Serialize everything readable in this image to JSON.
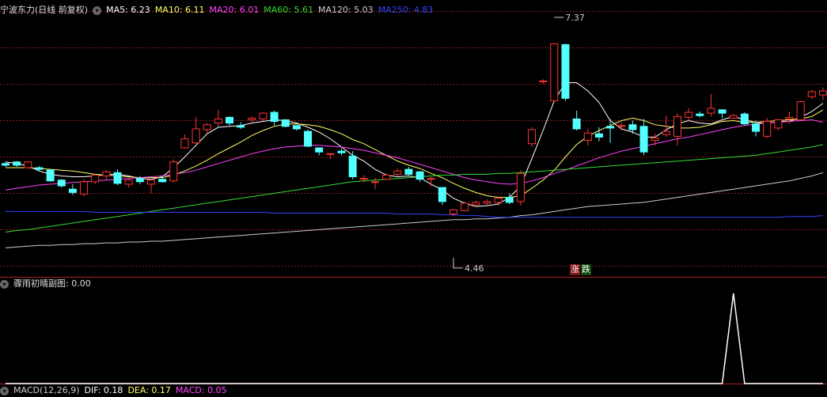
{
  "main_header": {
    "title": "宁波东力(日线 前复权)",
    "indicators": [
      {
        "label": "MA5: 6.23",
        "color": "#ffffff"
      },
      {
        "label": "MA10: 6.11",
        "color": "#ffff66"
      },
      {
        "label": "MA20: 6.01",
        "color": "#ff44ff"
      },
      {
        "label": "MA60: 5.61",
        "color": "#33dd33"
      },
      {
        "label": "MA120: 5.03",
        "color": "#cccccc"
      },
      {
        "label": "MA250: 4.83",
        "color": "#3344ff"
      }
    ]
  },
  "sub_header": {
    "title": "骤雨初晴副图",
    "value": ": 0.00"
  },
  "bottom_header": {
    "labels": [
      {
        "text": "MACD(12,26,9)",
        "color": "#cccccc"
      },
      {
        "text": "DIF: 0.18",
        "color": "#ffffff"
      },
      {
        "text": "DEA: 0.17",
        "color": "#ffff66"
      },
      {
        "text": "MACD: 0.05",
        "color": "#ff44ff"
      }
    ]
  },
  "badges": {
    "up": "涨",
    "down": "跌"
  },
  "colors": {
    "up": "#ff3333",
    "down": "#54ffff",
    "grid": "#8b1a1a",
    "divider": "#b02020",
    "axis_text": "#cccccc"
  },
  "chart_data": {
    "type": "candlestick",
    "ylim": [
      4.21,
      7.58
    ],
    "annotations": [
      {
        "text": "7.37",
        "kind": "high",
        "value": 7.37,
        "index": 49
      },
      {
        "text": "4.46",
        "kind": "low",
        "value": 4.46,
        "index": 40
      }
    ],
    "candles": [
      [
        5.6,
        5.62,
        5.56,
        5.58
      ],
      [
        5.62,
        5.63,
        5.56,
        5.58
      ],
      [
        5.55,
        5.63,
        5.54,
        5.62
      ],
      [
        5.55,
        5.57,
        5.51,
        5.53
      ],
      [
        5.52,
        5.53,
        5.38,
        5.39
      ],
      [
        5.4,
        5.41,
        5.31,
        5.33
      ],
      [
        5.29,
        5.35,
        5.22,
        5.25
      ],
      [
        5.23,
        5.41,
        5.2,
        5.38
      ],
      [
        5.38,
        5.48,
        5.35,
        5.46
      ],
      [
        5.45,
        5.52,
        5.4,
        5.5
      ],
      [
        5.49,
        5.53,
        5.34,
        5.36
      ],
      [
        5.35,
        5.42,
        5.31,
        5.4
      ],
      [
        5.42,
        5.45,
        5.35,
        5.38
      ],
      [
        5.35,
        5.42,
        5.24,
        5.4
      ],
      [
        5.41,
        5.45,
        5.37,
        5.38
      ],
      [
        5.39,
        5.65,
        5.37,
        5.62
      ],
      [
        5.79,
        5.95,
        5.78,
        5.9
      ],
      [
        5.85,
        6.16,
        5.84,
        6.02
      ],
      [
        6.01,
        6.09,
        5.97,
        6.07
      ],
      [
        6.09,
        6.25,
        6.05,
        6.14
      ],
      [
        6.16,
        6.17,
        6.06,
        6.09
      ],
      [
        6.06,
        6.1,
        6.02,
        6.04
      ],
      [
        6.13,
        6.17,
        6.1,
        6.15
      ],
      [
        6.14,
        6.22,
        6.12,
        6.21
      ],
      [
        6.22,
        6.24,
        6.06,
        6.11
      ],
      [
        6.13,
        6.13,
        6.04,
        6.05
      ],
      [
        6.06,
        6.06,
        6.0,
        6.02
      ],
      [
        5.99,
        6.01,
        5.8,
        5.81
      ],
      [
        5.79,
        5.79,
        5.7,
        5.74
      ],
      [
        5.72,
        5.72,
        5.65,
        5.72
      ],
      [
        5.75,
        5.78,
        5.7,
        5.73
      ],
      [
        5.69,
        5.75,
        5.41,
        5.44
      ],
      [
        5.42,
        5.46,
        5.37,
        5.42
      ],
      [
        5.38,
        5.43,
        5.29,
        5.38
      ],
      [
        5.41,
        5.48,
        5.4,
        5.46
      ],
      [
        5.47,
        5.54,
        5.45,
        5.51
      ],
      [
        5.53,
        5.56,
        5.46,
        5.47
      ],
      [
        5.5,
        5.51,
        5.38,
        5.41
      ],
      [
        5.42,
        5.44,
        5.32,
        5.42
      ],
      [
        5.31,
        5.31,
        5.1,
        5.14
      ],
      [
        4.99,
        5.05,
        4.96,
        5.04
      ],
      [
        5.03,
        5.14,
        5.02,
        5.12
      ],
      [
        5.1,
        5.15,
        5.08,
        5.13
      ],
      [
        5.12,
        5.17,
        5.1,
        5.14
      ],
      [
        5.13,
        5.2,
        5.09,
        5.18
      ],
      [
        5.19,
        5.24,
        5.11,
        5.13
      ],
      [
        5.14,
        5.52,
        5.09,
        5.48
      ],
      [
        5.84,
        6.04,
        5.8,
        6.01
      ],
      [
        6.59,
        6.62,
        6.56,
        6.6
      ],
      [
        6.36,
        7.06,
        6.34,
        7.05
      ],
      [
        7.04,
        7.05,
        6.36,
        6.39
      ],
      [
        6.14,
        6.24,
        6.0,
        6.02
      ],
      [
        5.88,
        6.02,
        5.82,
        5.97
      ],
      [
        5.96,
        6.04,
        5.87,
        5.92
      ],
      [
        6.05,
        6.14,
        5.85,
        6.03
      ],
      [
        6.05,
        6.1,
        6.0,
        6.06
      ],
      [
        6.07,
        6.12,
        5.96,
        6.01
      ],
      [
        6.05,
        6.14,
        5.7,
        5.74
      ],
      [
        5.88,
        5.96,
        5.82,
        5.91
      ],
      [
        5.95,
        6.18,
        5.92,
        5.99
      ],
      [
        5.93,
        6.21,
        5.82,
        6.17
      ],
      [
        6.16,
        6.27,
        6.12,
        6.22
      ],
      [
        6.2,
        6.23,
        6.16,
        6.18
      ],
      [
        6.21,
        6.44,
        6.17,
        6.27
      ],
      [
        6.25,
        6.26,
        6.15,
        6.21
      ],
      [
        6.15,
        6.2,
        6.14,
        6.18
      ],
      [
        6.2,
        6.22,
        6.07,
        6.08
      ],
      [
        6.08,
        6.12,
        5.93,
        5.99
      ],
      [
        5.93,
        6.15,
        5.91,
        6.11
      ],
      [
        6.03,
        6.14,
        6.0,
        6.13
      ],
      [
        6.14,
        6.23,
        6.08,
        6.16
      ],
      [
        6.13,
        6.36,
        6.12,
        6.35
      ],
      [
        6.41,
        6.49,
        6.38,
        6.47
      ],
      [
        6.43,
        6.52,
        6.37,
        6.48
      ]
    ],
    "ma_series": [
      {
        "name": "MA5",
        "color": "#ffffff",
        "values": [
          5.62,
          5.6,
          5.57,
          5.51,
          5.47,
          5.45,
          5.44,
          5.44,
          5.45,
          5.47,
          5.47,
          5.45,
          5.42,
          5.41,
          5.44,
          5.55,
          5.68,
          5.82,
          5.96,
          6.04,
          6.05,
          6.06,
          6.09,
          6.11,
          6.13,
          6.12,
          6.09,
          6.04,
          5.98,
          5.9,
          5.8,
          5.7,
          5.63,
          5.53,
          5.46,
          5.44,
          5.45,
          5.43,
          5.35,
          5.28,
          5.18,
          5.12,
          5.08,
          5.09,
          5.11,
          5.19,
          5.33,
          5.66,
          6.0,
          6.36,
          6.58,
          6.58,
          6.48,
          6.34,
          6.12,
          6.02,
          5.98,
          5.92,
          5.92,
          6.01,
          6.08,
          6.12,
          6.09,
          6.08,
          6.13,
          6.17,
          6.13,
          6.1,
          6.08,
          6.11,
          6.11,
          6.16,
          6.23,
          6.33
        ]
      },
      {
        "name": "MA10",
        "color": "#ffff66",
        "values": [
          5.55,
          5.55,
          5.55,
          5.54,
          5.53,
          5.52,
          5.51,
          5.49,
          5.47,
          5.46,
          5.45,
          5.44,
          5.43,
          5.43,
          5.43,
          5.46,
          5.51,
          5.57,
          5.64,
          5.72,
          5.79,
          5.86,
          5.94,
          6.0,
          6.05,
          6.08,
          6.08,
          6.07,
          6.05,
          6.01,
          5.96,
          5.89,
          5.84,
          5.77,
          5.7,
          5.63,
          5.58,
          5.54,
          5.48,
          5.43,
          5.36,
          5.3,
          5.25,
          5.21,
          5.19,
          5.19,
          5.21,
          5.3,
          5.4,
          5.52,
          5.68,
          5.83,
          5.93,
          6.0,
          6.06,
          6.12,
          6.15,
          6.12,
          6.07,
          6.05,
          6.03,
          6.03,
          6.04,
          6.07,
          6.11,
          6.12,
          6.1,
          6.1,
          6.11,
          6.12,
          6.13,
          6.14,
          6.17,
          6.25
        ]
      },
      {
        "name": "MA20",
        "color": "#ff44ff",
        "values": [
          5.28,
          5.3,
          5.32,
          5.34,
          5.35,
          5.36,
          5.37,
          5.38,
          5.39,
          5.4,
          5.41,
          5.42,
          5.43,
          5.44,
          5.45,
          5.47,
          5.49,
          5.52,
          5.56,
          5.6,
          5.64,
          5.68,
          5.72,
          5.75,
          5.78,
          5.8,
          5.81,
          5.82,
          5.82,
          5.81,
          5.8,
          5.78,
          5.76,
          5.73,
          5.7,
          5.67,
          5.63,
          5.59,
          5.55,
          5.51,
          5.47,
          5.43,
          5.4,
          5.38,
          5.36,
          5.35,
          5.36,
          5.39,
          5.43,
          5.48,
          5.52,
          5.57,
          5.62,
          5.67,
          5.71,
          5.75,
          5.78,
          5.81,
          5.84,
          5.87,
          5.9,
          5.92,
          5.95,
          5.98,
          6.01,
          6.04,
          6.06,
          6.08,
          6.09,
          6.1,
          6.11,
          6.12,
          6.13,
          6.1
        ]
      },
      {
        "name": "MA60",
        "color": "#33dd33",
        "values": [
          4.77,
          4.79,
          4.8,
          4.82,
          4.84,
          4.86,
          4.88,
          4.9,
          4.92,
          4.94,
          4.96,
          4.98,
          5.0,
          5.02,
          5.04,
          5.06,
          5.08,
          5.1,
          5.12,
          5.14,
          5.16,
          5.18,
          5.2,
          5.22,
          5.24,
          5.26,
          5.28,
          5.3,
          5.32,
          5.34,
          5.36,
          5.38,
          5.39,
          5.4,
          5.41,
          5.42,
          5.43,
          5.44,
          5.45,
          5.46,
          5.46,
          5.47,
          5.47,
          5.47,
          5.48,
          5.48,
          5.49,
          5.5,
          5.51,
          5.52,
          5.53,
          5.54,
          5.55,
          5.56,
          5.57,
          5.58,
          5.59,
          5.6,
          5.61,
          5.62,
          5.63,
          5.64,
          5.65,
          5.66,
          5.67,
          5.68,
          5.69,
          5.7,
          5.72,
          5.74,
          5.76,
          5.78,
          5.8,
          5.83
        ]
      },
      {
        "name": "MA120",
        "color": "#cccccc",
        "values": [
          4.58,
          4.59,
          4.6,
          4.61,
          4.61,
          4.62,
          4.62,
          4.63,
          4.63,
          4.64,
          4.64,
          4.65,
          4.65,
          4.66,
          4.66,
          4.67,
          4.68,
          4.69,
          4.7,
          4.71,
          4.72,
          4.73,
          4.74,
          4.75,
          4.76,
          4.77,
          4.78,
          4.79,
          4.8,
          4.81,
          4.82,
          4.83,
          4.84,
          4.85,
          4.86,
          4.87,
          4.88,
          4.89,
          4.9,
          4.91,
          4.92,
          4.92,
          4.93,
          4.93,
          4.94,
          4.95,
          4.97,
          4.98,
          5.0,
          5.02,
          5.04,
          5.06,
          5.08,
          5.09,
          5.1,
          5.11,
          5.12,
          5.13,
          5.15,
          5.17,
          5.19,
          5.21,
          5.23,
          5.25,
          5.27,
          5.29,
          5.31,
          5.33,
          5.35,
          5.37,
          5.39,
          5.42,
          5.45,
          5.49
        ]
      },
      {
        "name": "MA250",
        "color": "#3344ff",
        "values": [
          5.02,
          5.02,
          5.02,
          5.02,
          5.02,
          5.02,
          5.02,
          5.02,
          5.01,
          5.01,
          5.01,
          5.01,
          5.01,
          5.01,
          5.01,
          5.01,
          5.01,
          5.01,
          5.01,
          5.01,
          5.01,
          5.01,
          5.01,
          5.01,
          5.0,
          5.0,
          5.0,
          5.0,
          5.0,
          5.0,
          5.0,
          5.0,
          5.0,
          5.0,
          5.0,
          4.99,
          4.99,
          4.99,
          4.99,
          4.98,
          4.98,
          4.97,
          4.97,
          4.96,
          4.95,
          4.95,
          4.95,
          4.95,
          4.95,
          4.95,
          4.95,
          4.95,
          4.95,
          4.95,
          4.95,
          4.95,
          4.95,
          4.95,
          4.95,
          4.95,
          4.95,
          4.95,
          4.95,
          4.95,
          4.95,
          4.95,
          4.95,
          4.95,
          4.95,
          4.95,
          4.96,
          4.96,
          4.96,
          4.97
        ]
      }
    ],
    "sub_indicator": {
      "name": "骤雨初晴副图",
      "color": "#ffffff",
      "values": [
        0,
        0,
        0,
        0,
        0,
        0,
        0,
        0,
        0,
        0,
        0,
        0,
        0,
        0,
        0,
        0,
        0,
        0,
        0,
        0,
        0,
        0,
        0,
        0,
        0,
        0,
        0,
        0,
        0,
        0,
        0,
        0,
        0,
        0,
        0,
        0,
        0,
        0,
        0,
        0,
        0,
        0,
        0,
        0,
        0,
        0,
        0,
        0,
        0,
        0,
        0,
        0,
        0,
        0,
        0,
        0,
        0,
        0,
        0,
        0,
        0,
        0,
        0,
        0,
        0,
        1,
        0,
        0,
        0,
        0,
        0,
        0,
        0,
        0
      ]
    }
  }
}
